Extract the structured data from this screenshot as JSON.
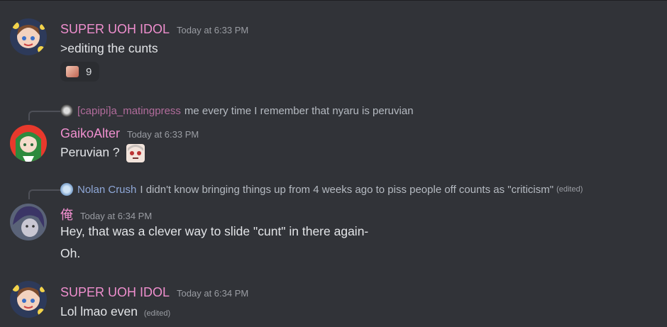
{
  "messages": [
    {
      "username": "SUPER UOH IDOL",
      "timestamp": "Today at 6:33 PM",
      "text": ">editing the cunts",
      "reaction": {
        "emoji": "face-emoji",
        "count": "9"
      }
    },
    {
      "reply": {
        "username": "[capipi]a_matingpress",
        "text": "me every time I remember that nyaru is peruvian"
      },
      "username": "GaikoAlter",
      "timestamp": "Today at 6:33 PM",
      "text": "Peruvian ?"
    },
    {
      "reply": {
        "username": "Nolan Crush",
        "text": "I didn't know bringing things up from 4 weeks ago to piss people off counts as \"criticism\"",
        "edited": "(edited)"
      },
      "username": "俺",
      "timestamp": "Today at 6:34 PM",
      "lines": [
        "Hey, that was a clever way to slide \"cunt\" in there again-",
        "Oh."
      ]
    },
    {
      "username": "SUPER UOH IDOL",
      "timestamp": "Today at 6:34 PM",
      "text": "Lol lmao even",
      "edited": "(edited)"
    }
  ],
  "colors": {
    "background": "#313338",
    "username": "#ef8fce",
    "timestamp": "#9a9da3",
    "text": "#e3e5e8"
  }
}
